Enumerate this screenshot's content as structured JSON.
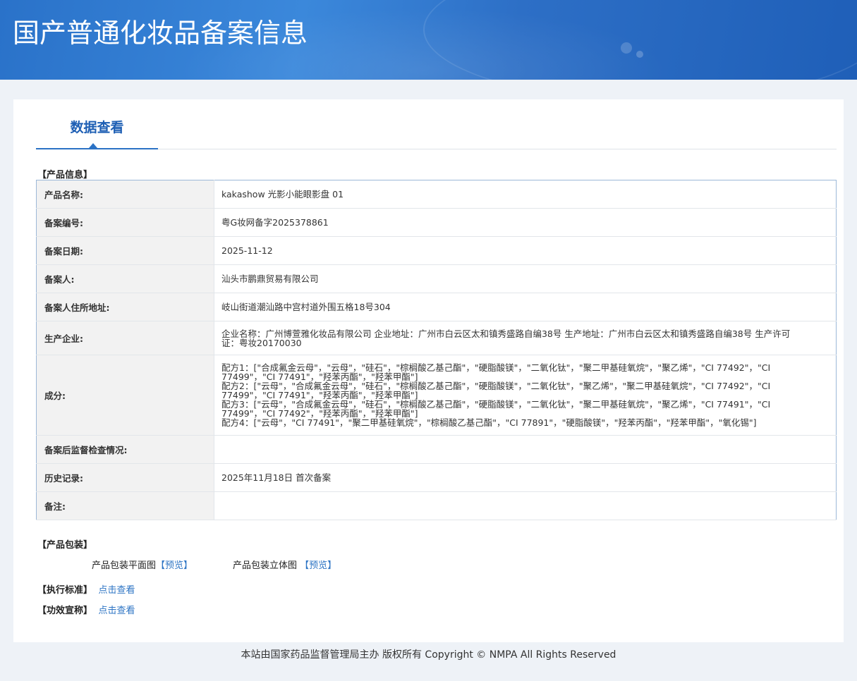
{
  "header": {
    "title": "国产普通化妆品备案信息"
  },
  "tabs": {
    "active_label": "数据查看"
  },
  "product_info": {
    "section_title": "【产品信息】",
    "rows": [
      {
        "label": "产品名称:",
        "value": "kakashow 光影小能眼影盘 01"
      },
      {
        "label": "备案编号:",
        "value": "粤G妆网备字2025378861"
      },
      {
        "label": "备案日期:",
        "value": "2025-11-12"
      },
      {
        "label": "备案人:",
        "value": "汕头市鹏鼎贸易有限公司"
      },
      {
        "label": "备案人住所地址:",
        "value": "岐山街道潮汕路中宫村道外围五格18号304"
      },
      {
        "label": "生产企业:",
        "value": "企业名称：广州博萱雅化妆品有限公司 企业地址：广州市白云区太和镇秀盛路自编38号 生产地址：广州市白云区太和镇秀盛路自编38号 生产许可证：粤妆20170030"
      },
      {
        "label": "成分:",
        "value": "配方1：[\"合成氟金云母\"，\"云母\"，\"硅石\"，\"棕榈酸乙基己酯\"，\"硬脂酸镁\"，\"二氧化钛\"，\"聚二甲基硅氧烷\"，\"聚乙烯\"，\"CI 77492\"，\"CI 77499\"，\"CI 77491\"，\"羟苯丙酯\"，\"羟苯甲酯\"]\n配方2：[\"云母\"，\"合成氟金云母\"，\"硅石\"，\"棕榈酸乙基己酯\"，\"硬脂酸镁\"，\"二氧化钛\"，\"聚乙烯\"，\"聚二甲基硅氧烷\"，\"CI 77492\"，\"CI 77499\"，\"CI 77491\"，\"羟苯丙酯\"，\"羟苯甲酯\"]\n配方3：[\"云母\"，\"合成氟金云母\"，\"硅石\"，\"棕榈酸乙基己酯\"，\"硬脂酸镁\"，\"二氧化钛\"，\"聚二甲基硅氧烷\"，\"聚乙烯\"，\"CI 77491\"，\"CI 77499\"，\"CI 77492\"，\"羟苯丙酯\"，\"羟苯甲酯\"]\n配方4：[\"云母\"，\"CI 77491\"，\"聚二甲基硅氧烷\"，\"棕榈酸乙基己酯\"，\"CI 77891\"，\"硬脂酸镁\"，\"羟苯丙酯\"，\"羟苯甲酯\"，\"氧化锡\"]"
      },
      {
        "label": "备案后监督检查情况:",
        "value": ""
      },
      {
        "label": "历史记录:",
        "value": "2025年11月18日 首次备案"
      },
      {
        "label": "备注:",
        "value": ""
      }
    ]
  },
  "packaging": {
    "section_title": "【产品包装】",
    "flat_label": "产品包装平面图",
    "flat_link": "【预览】",
    "solid_label": "产品包装立体图",
    "solid_link": "【预览】"
  },
  "standard": {
    "section_title": "【执行标准】",
    "link": "点击查看"
  },
  "efficacy": {
    "section_title": "【功效宣称】",
    "link": "点击查看"
  },
  "footer": {
    "text": "本站由国家药品监督管理局主办 版权所有 Copyright © NMPA All Rights Reserved"
  }
}
